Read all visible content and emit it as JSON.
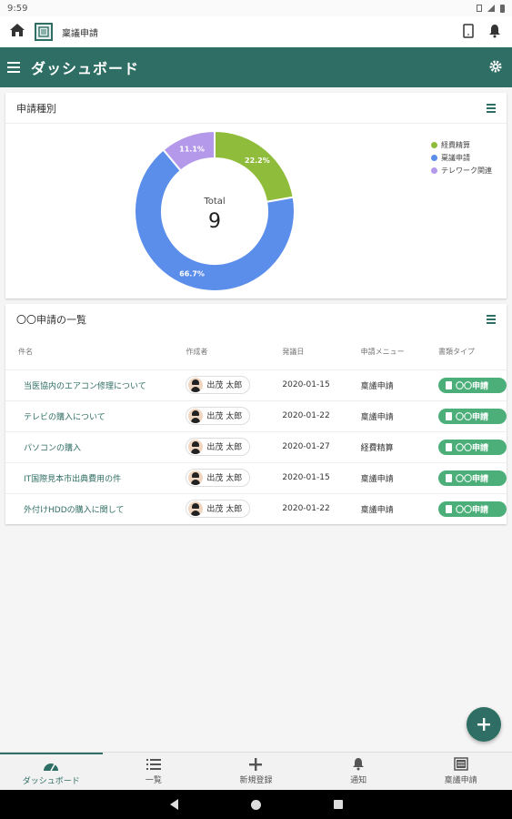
{
  "status": {
    "time": "9:59"
  },
  "topbar": {
    "app_title": "稟議申請"
  },
  "appbar": {
    "title": "ダッシュボード"
  },
  "chart_card": {
    "title": "申請種別"
  },
  "chart_data": {
    "type": "pie",
    "categories": [
      "経費精算",
      "稟議申請",
      "テレワーク関連"
    ],
    "values": [
      22.2,
      66.7,
      11.1
    ],
    "data_labels": [
      "22.2%",
      "66.7%",
      "11.1%"
    ],
    "colors": [
      "#8fbc3a",
      "#5b8dea",
      "#b499ea"
    ],
    "center_label": "Total",
    "center_value": "9",
    "legend_position": "top-right"
  },
  "table_card": {
    "title": "〇〇申請の一覧",
    "columns": [
      "件名",
      "作成者",
      "発議日",
      "申請メニュー",
      "書類タイプ"
    ],
    "rows": [
      {
        "subject": "当医協内のエアコン修理について",
        "author": "出茂 太郎",
        "date": "2020-01-15",
        "menu": "稟議申請",
        "type": "〇〇申請"
      },
      {
        "subject": "テレビの購入について",
        "author": "出茂 太郎",
        "date": "2020-01-22",
        "menu": "稟議申請",
        "type": "〇〇申請"
      },
      {
        "subject": "パソコンの購入",
        "author": "出茂 太郎",
        "date": "2020-01-27",
        "menu": "経費精算",
        "type": "〇〇申請"
      },
      {
        "subject": "IT国際見本市出典費用の件",
        "author": "出茂 太郎",
        "date": "2020-01-15",
        "menu": "稟議申請",
        "type": "〇〇申請"
      },
      {
        "subject": "外付けHDDの購入に関して",
        "author": "出茂 太郎",
        "date": "2020-01-22",
        "menu": "稟議申請",
        "type": "〇〇申請"
      }
    ]
  },
  "bottom_nav": {
    "items": [
      {
        "label": "ダッシュボード",
        "icon": "dashboard-icon"
      },
      {
        "label": "一覧",
        "icon": "list-icon"
      },
      {
        "label": "新規登録",
        "icon": "plus-icon"
      },
      {
        "label": "通知",
        "icon": "bell-icon"
      },
      {
        "label": "稟議申請",
        "icon": "document-icon"
      }
    ]
  }
}
